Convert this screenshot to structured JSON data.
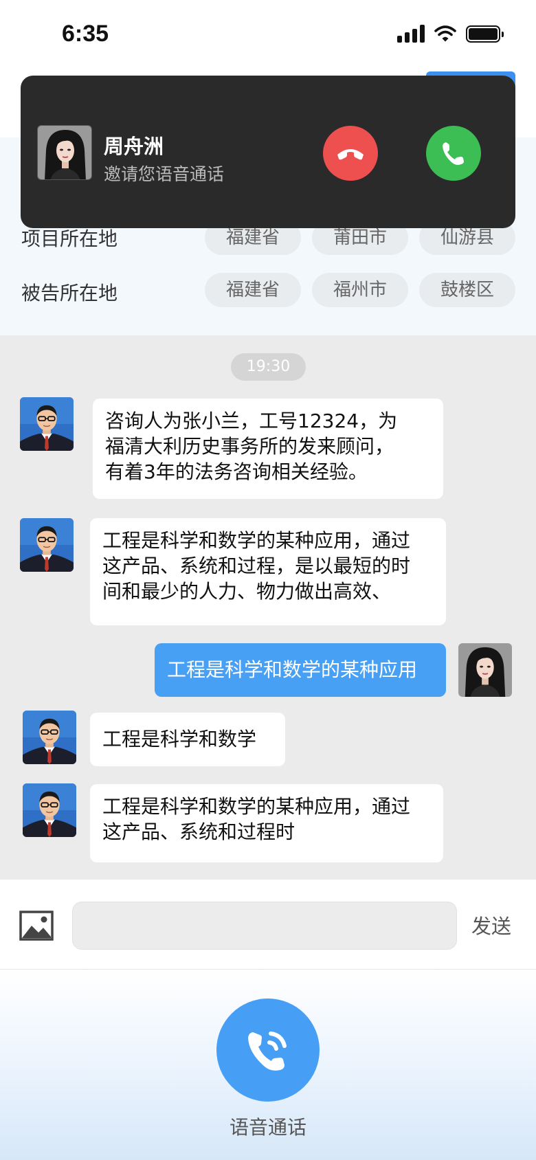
{
  "status_bar": {
    "time": "6:35"
  },
  "info": {
    "rows": [
      {
        "label": "项目所在地",
        "chips": [
          "福建省",
          "莆田市",
          "仙游县"
        ]
      },
      {
        "label": "被告所在地",
        "chips": [
          "福建省",
          "福州市",
          "鼓楼区"
        ]
      }
    ]
  },
  "chat": {
    "time_divider": "19:30",
    "messages": [
      {
        "from": "consultant",
        "lines": [
          "咨询人为张小兰，工号12324，为",
          "福清大利历史事务所的发来顾问，",
          "有着3年的法务咨询相关经验。"
        ]
      },
      {
        "from": "consultant",
        "lines": [
          "工程是科学和数学的某种应用，通过",
          "这产品、系统和过程，是以最短的时",
          "间和最少的人力、物力做出高效、"
        ]
      },
      {
        "from": "self",
        "text": "工程是科学和数学的某种应用"
      },
      {
        "from": "consultant",
        "text": "工程是科学和数学"
      },
      {
        "from": "consultant",
        "lines": [
          "工程是科学和数学的某种应用，通过",
          "这产品、系统和过程时"
        ]
      }
    ]
  },
  "input_bar": {
    "icon": "image-icon",
    "input_value": "",
    "send_label": "发送"
  },
  "voice_call": {
    "label": "语音通话",
    "icon": "phone-call-icon"
  },
  "call_banner": {
    "caller_name": "周舟洲",
    "subtitle": "邀请您语音通话",
    "decline_icon": "hang-up-icon",
    "accept_icon": "phone-icon"
  },
  "colors": {
    "accent_blue": "#48a0f5",
    "decline_red": "#ee4f4f",
    "accept_green": "#3cbe55",
    "banner_bg": "#2a2a2a"
  }
}
